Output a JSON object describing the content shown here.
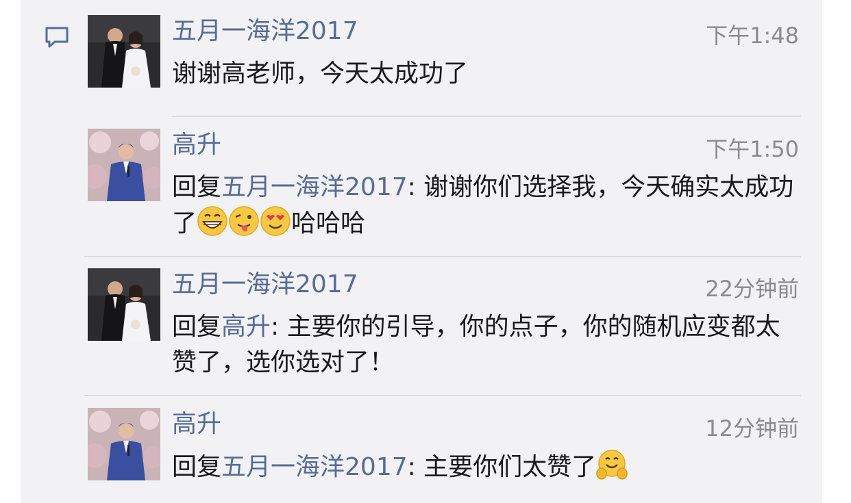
{
  "comments": [
    {
      "author": "五月一海洋2017",
      "time": "下午1:48",
      "text": "谢谢高老师，今天太成功了"
    },
    {
      "author": "高升",
      "time": "下午1:50",
      "reply_prefix": "回复",
      "reply_to": "五月一海洋2017",
      "text": ": 谢谢你们选择我，今天确实太成功了",
      "emojis": [
        "grin-emoji",
        "wink-tongue-emoji",
        "heart-eyes-emoji"
      ],
      "suffix": "哈哈哈"
    },
    {
      "author": "五月一海洋2017",
      "time": "22分钟前",
      "reply_prefix": "回复",
      "reply_to": "高升",
      "text": ": 主要你的引导，你的点子，你的随机应变都太赞了，选你选对了！"
    },
    {
      "author": "高升",
      "time": "12分钟前",
      "reply_prefix": "回复",
      "reply_to": "五月一海洋2017",
      "text": ": 主要你们太赞了",
      "emojis": [
        "clapping-smile-emoji"
      ]
    }
  ]
}
